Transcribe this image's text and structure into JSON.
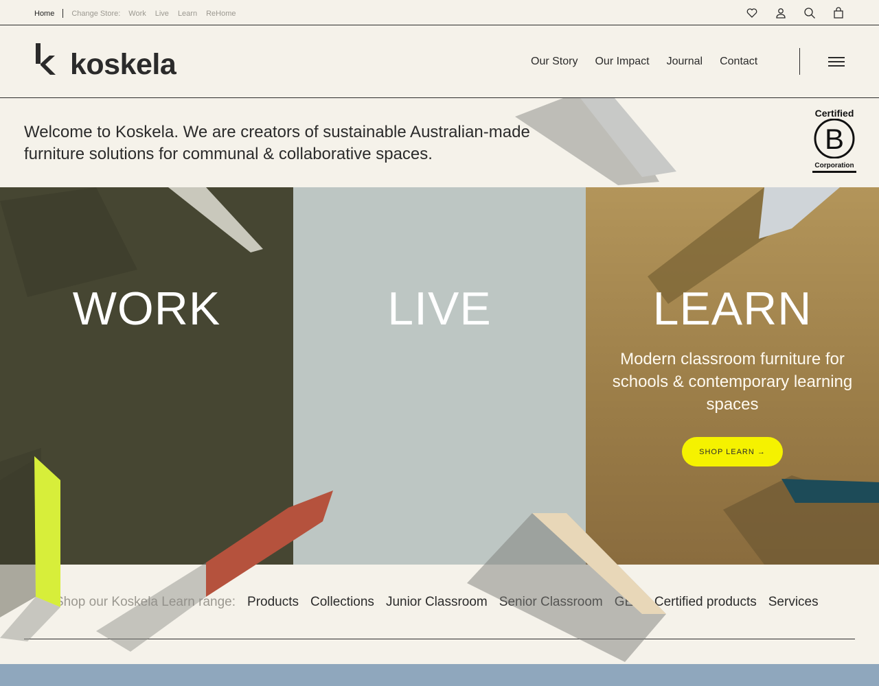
{
  "topbar": {
    "home": "Home",
    "change_store": "Change Store:",
    "stores": [
      "Work",
      "Live",
      "Learn",
      "ReHome"
    ]
  },
  "header": {
    "logo": "koskela",
    "nav": [
      "Our Story",
      "Our Impact",
      "Journal",
      "Contact"
    ]
  },
  "welcome": "Welcome to Koskela. We are creators of sustainable Australian-made furniture solutions for communal & collaborative spaces.",
  "bcorp": {
    "certified": "Certified",
    "letter": "B",
    "corporation": "Corporation"
  },
  "panels": {
    "work": "WORK",
    "live": "LIVE",
    "learn": "LEARN",
    "learn_desc": "Modern classroom furniture for schools & contemporary learning spaces",
    "shop_button": "SHOP LEARN →"
  },
  "range": {
    "label": "Shop our Koskela Learn range:",
    "links": [
      "Products",
      "Collections",
      "Junior Classroom",
      "Senior Classroom",
      "GECA Certified products",
      "Services"
    ]
  },
  "colors": {
    "background": "#f5f2ea",
    "work": "#464632",
    "live": "#bdc6c3",
    "learn": "#b3955a",
    "button": "#f5f200",
    "band": "#8fa7bd"
  }
}
